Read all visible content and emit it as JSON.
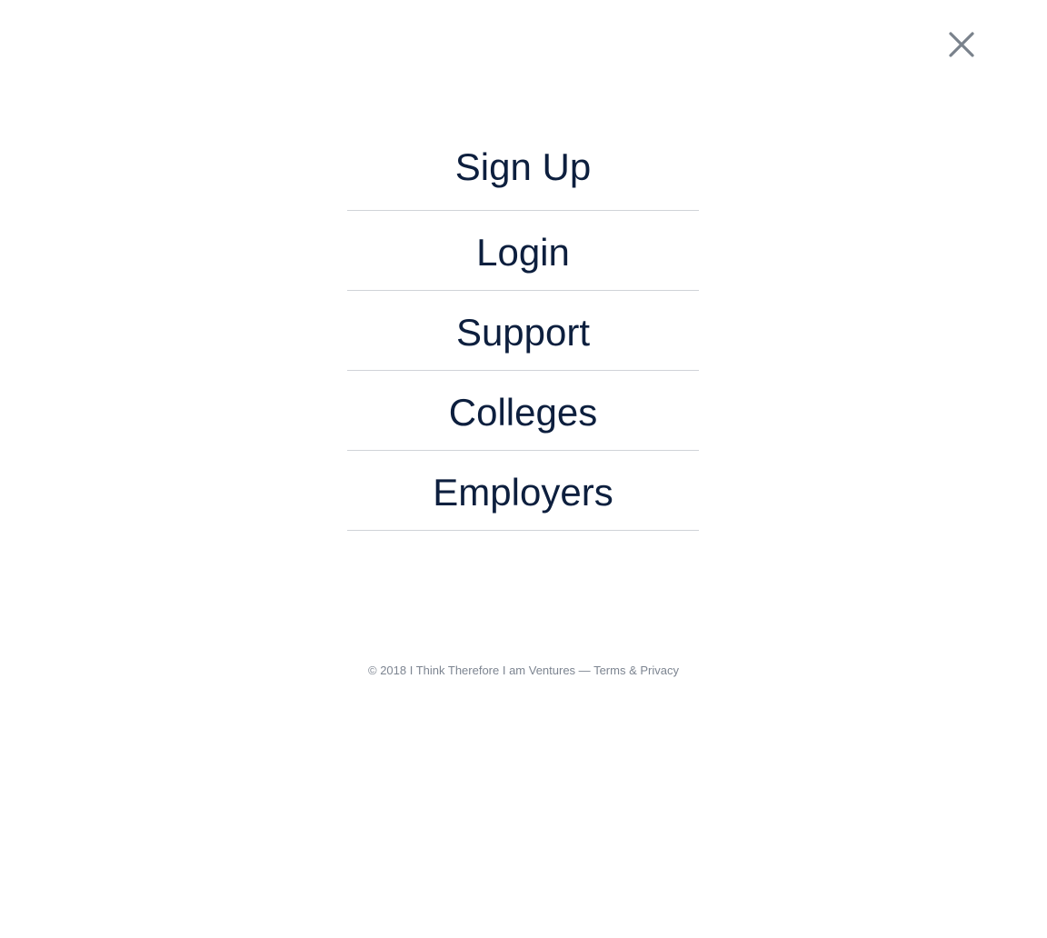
{
  "close_icon": "close-x-icon",
  "colors": {
    "text": "#0d1f3e",
    "divider": "#d0d3d8",
    "muted": "#7d8591"
  },
  "menu": {
    "items": [
      {
        "label": "Sign Up"
      },
      {
        "label": "Login"
      },
      {
        "label": "Support"
      },
      {
        "label": "Colleges"
      },
      {
        "label": "Employers"
      }
    ]
  },
  "footer": {
    "copyright": "© 2018 I Think Therefore I am Ventures —",
    "terms": "Terms",
    "amp": "&",
    "privacy": "Privacy"
  }
}
